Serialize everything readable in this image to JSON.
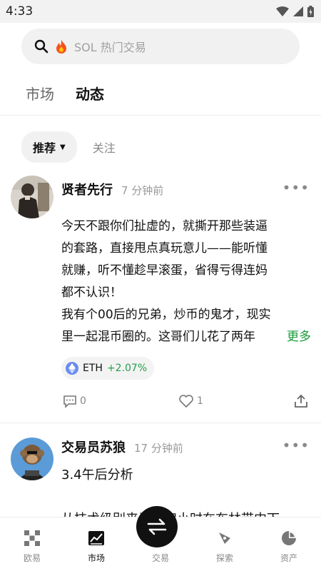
{
  "status_bar": {
    "time": "4:33"
  },
  "search": {
    "placeholder": "SOL 热门交易"
  },
  "top_tabs": [
    {
      "label": "市场",
      "active": false
    },
    {
      "label": "动态",
      "active": true
    }
  ],
  "filters": {
    "recommend": "推荐",
    "follow": "关注"
  },
  "posts": [
    {
      "author": "贤者先行",
      "time": "7 分钟前",
      "body_lines": [
        "今天不跟你们扯虚的，就撕开那些装逼",
        "的套路，直接甩点真玩意儿——能听懂",
        "就赚，听不懂趁早滚蛋，省得亏得连妈",
        "都不认识！",
        "我有个00后的兄弟，炒币的鬼才，现实",
        "里一起混币圈的。这哥们儿花了两年"
      ],
      "read_more": "更多",
      "token": {
        "symbol": "ETH",
        "change": "+2.07%"
      },
      "comments": "0",
      "likes": "1"
    },
    {
      "author": "交易员苏狼",
      "time": "17 分钟前",
      "subtitle": "3.4午后分析",
      "line": "从技术级别来看，四小时在布林带中下"
    }
  ],
  "bottom_nav": [
    {
      "label": "欧易",
      "icon": "okx-logo-icon",
      "active": false
    },
    {
      "label": "市场",
      "icon": "chart-icon",
      "active": true
    },
    {
      "label": "交易",
      "icon": "swap-icon",
      "active": false
    },
    {
      "label": "探索",
      "icon": "compass-icon",
      "active": false
    },
    {
      "label": "资产",
      "icon": "pie-icon",
      "active": false
    }
  ],
  "colors": {
    "accent_green": "#1a9a3a",
    "positive": "#22a04a",
    "eth": "#6b8cef"
  }
}
